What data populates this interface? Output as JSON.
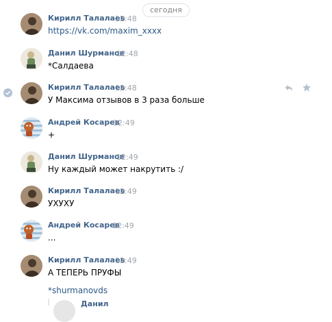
{
  "date_divider": "сегодня",
  "messages": [
    {
      "author": "Кирилл Талалаев",
      "time": "12:48",
      "text": "https://vk.com/maxim_xxxx",
      "avatar": "kirill"
    },
    {
      "author": "Данил Шурманов",
      "time": "12:48",
      "text": "*Салдаева",
      "avatar": "danil"
    },
    {
      "author": "Кирилл Талалаев",
      "time": "12:48",
      "text": "У Максима отзывов в 3 раза больше",
      "avatar": "kirill"
    },
    {
      "author": "Андрей Косарев",
      "time": "12:49",
      "text": "+",
      "avatar": "andrey"
    },
    {
      "author": "Данил Шурманов",
      "time": "12:49",
      "text": "Ну каждый может накрутить :/",
      "avatar": "danil"
    },
    {
      "author": "Кирилл Талалаев",
      "time": "12:49",
      "text": "УХУХУ",
      "avatar": "kirill"
    },
    {
      "author": "Андрей Косарев",
      "time": "12:49",
      "text": "...",
      "avatar": "andrey"
    },
    {
      "author": "Кирилл Талалаев",
      "time": "12:49",
      "text": "А ТЕПЕРЬ ПРУФЫ",
      "avatar": "kirill"
    }
  ],
  "forwarded": {
    "reference": "*shurmanovds",
    "quoted_author": "Данил"
  },
  "icons": {
    "selected": "check-icon",
    "reply": "reply-icon",
    "favorite": "star-icon"
  },
  "colors": {
    "author_name": "#42648b",
    "link": "#2a5885",
    "timestamp": "#a0a6ad"
  }
}
